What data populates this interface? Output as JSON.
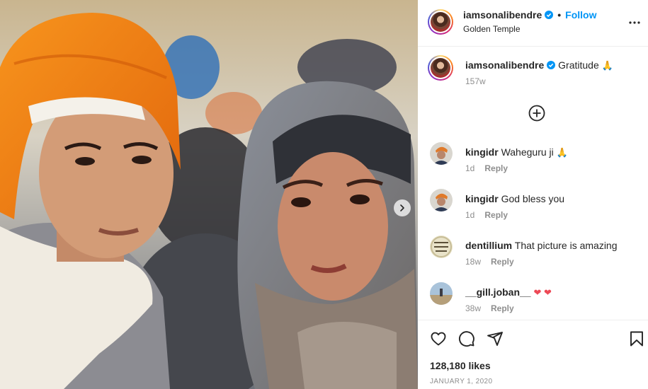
{
  "post": {
    "image_alt": "Photo of a boy in an orange turban and a woman in a grey head scarf at the Golden Temple",
    "author": {
      "username": "iamsonalibendre",
      "verified": true,
      "follow_label": "Follow",
      "separator": "•",
      "location": "Golden Temple"
    },
    "caption": {
      "username": "iamsonalibendre",
      "text": "Gratitude",
      "emoji": "🙏",
      "time": "157w"
    },
    "comments": [
      {
        "username": "kingidr",
        "text": "Waheguru ji",
        "emoji": "🙏",
        "time": "1d",
        "reply_label": "Reply",
        "avatar": "turban-avatar"
      },
      {
        "username": "kingidr",
        "text": "God bless you",
        "emoji": "",
        "time": "1d",
        "reply_label": "Reply",
        "avatar": "turban-avatar"
      },
      {
        "username": "dentillium",
        "text": "That picture is amazing",
        "emoji": "",
        "time": "18w",
        "reply_label": "Reply",
        "avatar": "sign-avatar"
      },
      {
        "username": "__gill.joban__",
        "text": "",
        "emoji": "❤ ❤",
        "time": "38w",
        "reply_label": "Reply",
        "avatar": "landscape-avatar"
      }
    ],
    "likes": "128,180 likes",
    "date": "JANUARY 1, 2020",
    "icons": [
      "more-icon",
      "add-comment-icon",
      "heart-icon",
      "comment-icon",
      "share-icon",
      "bookmark-icon",
      "chevron-right-icon",
      "verified-icon"
    ],
    "colors": {
      "link": "#0095f6",
      "secondary": "#8e8e8e",
      "heart": "#ed4956",
      "verified": "#0095f6"
    }
  }
}
